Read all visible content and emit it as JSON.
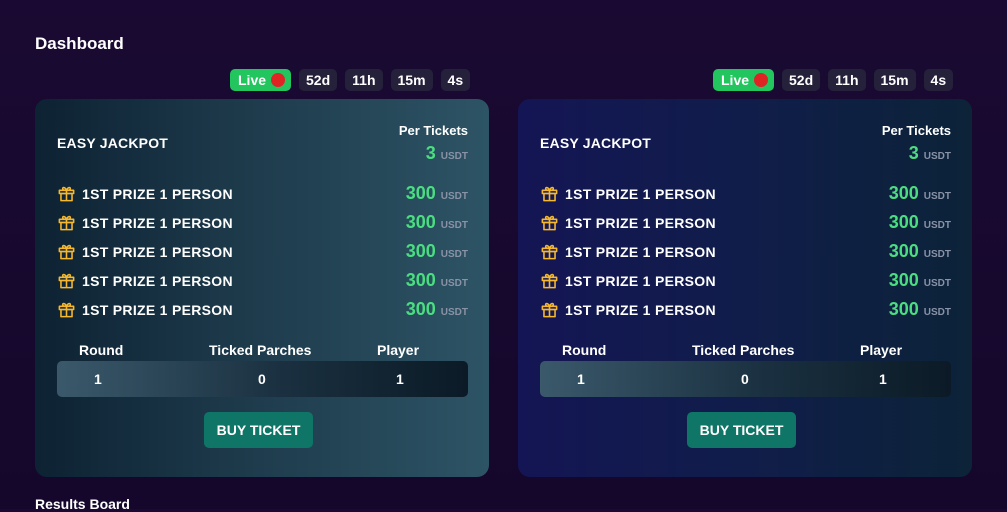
{
  "page": {
    "title": "Dashboard",
    "results_title": "Results Board"
  },
  "colors": {
    "live": "#22c55e",
    "live_dot": "#e02424",
    "accent_green": "#4ade80",
    "button": "#0f7566"
  },
  "cards": [
    {
      "timer": {
        "live_label": "Live",
        "days": "52d",
        "hours": "11h",
        "minutes": "15m",
        "seconds": "4s"
      },
      "name": "EASY JACKPOT",
      "per_tickets_label": "Per Tickets",
      "per_tickets_value": "3",
      "per_tickets_unit": "USDT",
      "prizes": [
        {
          "icon": "gift-icon",
          "label": "1ST PRIZE 1 PERSON",
          "amount": "300",
          "unit": "USDT"
        },
        {
          "icon": "gift-icon",
          "label": "1ST PRIZE 1 PERSON",
          "amount": "300",
          "unit": "USDT"
        },
        {
          "icon": "gift-icon",
          "label": "1ST PRIZE 1 PERSON",
          "amount": "300",
          "unit": "USDT"
        },
        {
          "icon": "gift-icon",
          "label": "1ST PRIZE 1 PERSON",
          "amount": "300",
          "unit": "USDT"
        },
        {
          "icon": "gift-icon",
          "label": "1ST PRIZE 1 PERSON",
          "amount": "300",
          "unit": "USDT"
        }
      ],
      "stats_headers": {
        "round": "Round",
        "ticked": "Ticked Parches",
        "player": "Player"
      },
      "stats_values": {
        "round": "1",
        "ticked": "0",
        "player": "1"
      },
      "buy_label": "BUY TICKET"
    },
    {
      "timer": {
        "live_label": "Live",
        "days": "52d",
        "hours": "11h",
        "minutes": "15m",
        "seconds": "4s"
      },
      "name": "EASY JACKPOT",
      "per_tickets_label": "Per Tickets",
      "per_tickets_value": "3",
      "per_tickets_unit": "USDT",
      "prizes": [
        {
          "icon": "gift-icon",
          "label": "1ST PRIZE 1 PERSON",
          "amount": "300",
          "unit": "USDT"
        },
        {
          "icon": "gift-icon",
          "label": "1ST PRIZE 1 PERSON",
          "amount": "300",
          "unit": "USDT"
        },
        {
          "icon": "gift-icon",
          "label": "1ST PRIZE 1 PERSON",
          "amount": "300",
          "unit": "USDT"
        },
        {
          "icon": "gift-icon",
          "label": "1ST PRIZE 1 PERSON",
          "amount": "300",
          "unit": "USDT"
        },
        {
          "icon": "gift-icon",
          "label": "1ST PRIZE 1 PERSON",
          "amount": "300",
          "unit": "USDT"
        }
      ],
      "stats_headers": {
        "round": "Round",
        "ticked": "Ticked Parches",
        "player": "Player"
      },
      "stats_values": {
        "round": "1",
        "ticked": "0",
        "player": "1"
      },
      "buy_label": "BUY TICKET"
    }
  ]
}
